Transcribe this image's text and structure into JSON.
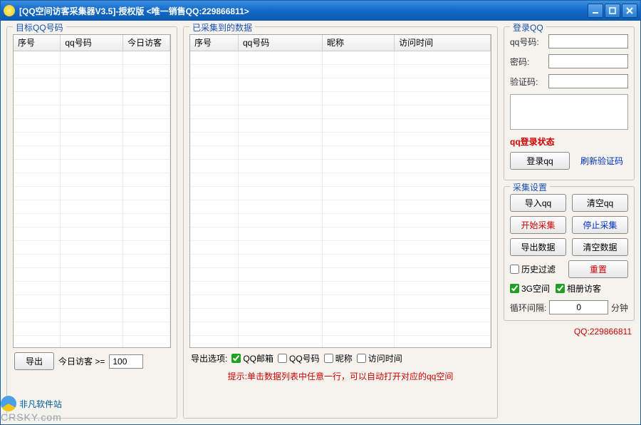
{
  "title": "[QQ空间访客采集器V3.5]-授权版 <唯一销售QQ:229866811>",
  "left": {
    "legend": "目标QQ号码",
    "cols": [
      "序号",
      "qq号码",
      "今日访客"
    ],
    "export_btn": "导出",
    "today_label": "今日访客 >=",
    "today_value": "100"
  },
  "mid": {
    "legend": "已采集到的数据",
    "cols": [
      "序号",
      "qq号码",
      "昵称",
      "访问时间"
    ],
    "export_label": "导出选项:",
    "opts": {
      "email": "QQ邮箱",
      "qq": "QQ号码",
      "nick": "昵称",
      "time": "访问时间"
    },
    "tip": "提示:单击数据列表中任意一行，可以自动打开对应的qq空间"
  },
  "login": {
    "legend": "登录QQ",
    "qq_label": "qq号码:",
    "pwd_label": "密码:",
    "captcha_label": "验证码:",
    "status": "qq登录状态",
    "login_btn": "登录qq",
    "refresh_link": "刷新验证码"
  },
  "collect": {
    "legend": "采集设置",
    "import_btn": "导入qq",
    "clear_qq_btn": "清空qq",
    "start_btn": "开始采集",
    "stop_btn": "停止采集",
    "export_btn": "导出数据",
    "clear_data_btn": "清空数据",
    "history_filter": "历史过滤",
    "reset_btn": "重置",
    "space3g": "3G空间",
    "album": "相册访客",
    "loop_label": "循环间隔:",
    "loop_value": "0",
    "loop_unit": "分钟"
  },
  "footer": {
    "site1": "非凡软件站",
    "site2": "CRSKY.com",
    "qq_link": "QQ:229866811"
  }
}
